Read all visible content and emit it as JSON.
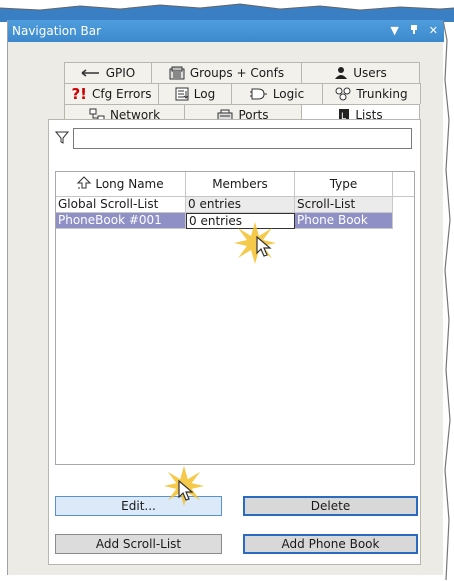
{
  "window": {
    "title": "Navigation Bar",
    "controls": [
      "▼",
      "ᵖ",
      "✕"
    ]
  },
  "tabs": {
    "row1": [
      {
        "label": "GPIO",
        "icon": "gpio-icon"
      },
      {
        "label": "Groups + Confs",
        "icon": "groups-icon"
      },
      {
        "label": "Users",
        "icon": "users-icon"
      }
    ],
    "row2": [
      {
        "label": "Cfg Errors",
        "icon": "error-icon"
      },
      {
        "label": "Log",
        "icon": "log-icon"
      },
      {
        "label": "Logic",
        "icon": "logic-icon"
      },
      {
        "label": "Trunking",
        "icon": "trunking-icon"
      }
    ],
    "row3": [
      {
        "label": "Network",
        "icon": "network-icon"
      },
      {
        "label": "Ports",
        "icon": "ports-icon"
      },
      {
        "label": "Lists",
        "icon": "lists-icon",
        "active": true
      }
    ]
  },
  "filter": {
    "value": "",
    "icon": "filter-icon"
  },
  "grid": {
    "columns": [
      "Long Name",
      "Members",
      "Type"
    ],
    "sort_icon": "sort-up-icon",
    "rows": [
      {
        "name": "Global Scroll-List",
        "members": "0 entries",
        "type": "Scroll-List",
        "selected": false
      },
      {
        "name": "PhoneBook #001",
        "members": "0 entries",
        "type": "Phone Book",
        "selected": true
      }
    ]
  },
  "buttons": {
    "edit": "Edit...",
    "delete": "Delete",
    "add_scroll": "Add Scroll-List",
    "add_phonebook": "Add Phone Book"
  },
  "colors": {
    "accent": "#3d89cd",
    "selection": "#8e90c6",
    "button_border": "#2a6bbf",
    "highlight": "#f3c12a"
  }
}
